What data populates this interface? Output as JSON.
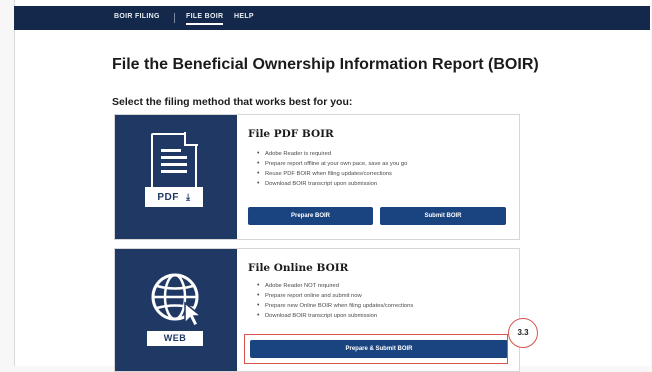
{
  "nav": {
    "items": [
      "BOIR FILING",
      "FILE BOIR",
      "HELP"
    ],
    "active_index": 1
  },
  "page": {
    "title": "File the Beneficial Ownership Information Report (BOIR)",
    "subtitle": "Select the filing method that works best for you:"
  },
  "pdf_card": {
    "icon_label": "PDF",
    "title": "File PDF BOIR",
    "bullets": [
      "Adobe Reader is required",
      "Prepare report offline at your own pace, save as you go",
      "Reuse PDF BOIR when filing updates/corrections",
      "Download BOIR transcript upon submission"
    ],
    "prepare_label": "Prepare BOIR",
    "submit_label": "Submit BOIR"
  },
  "web_card": {
    "icon_label": "WEB",
    "title": "File Online BOIR",
    "bullets": [
      "Adobe Reader NOT required",
      "Prepare report online and submit now",
      "Prepare new Online BOIR when filing updates/corrections",
      "Download BOIR transcript upon submission"
    ],
    "prepare_submit_label": "Prepare & Submit BOIR"
  },
  "annotation": {
    "step_label": "3.3"
  },
  "colors": {
    "nav_bg": "#14284b",
    "card_side": "#1f3864",
    "button": "#1a4480",
    "callout": "#d9534f"
  }
}
